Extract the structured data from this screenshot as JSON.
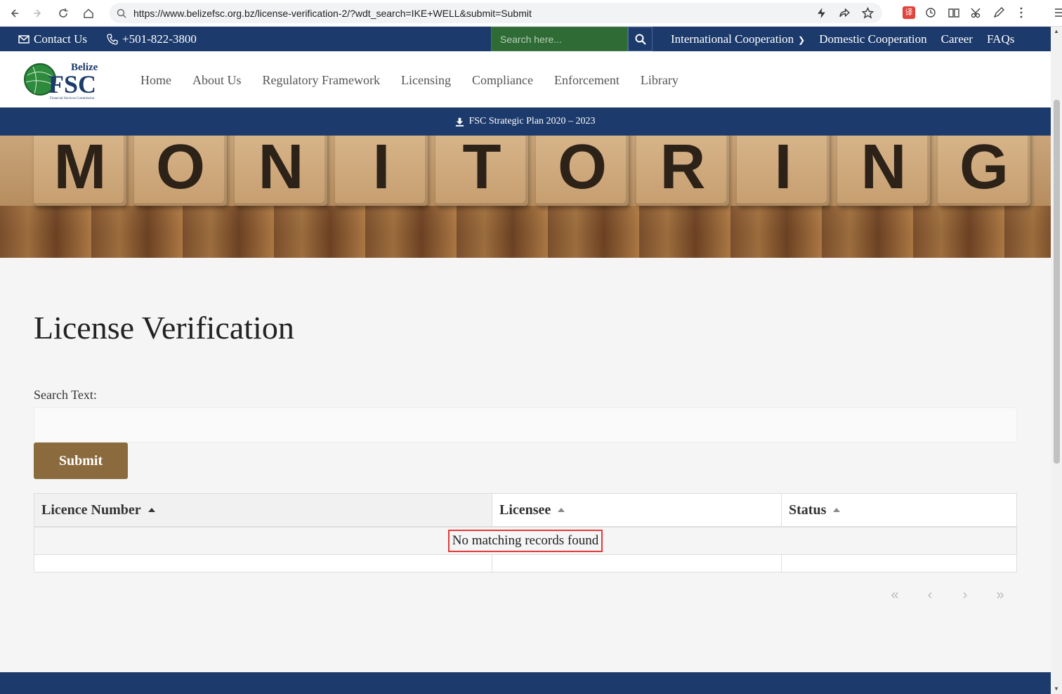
{
  "browser": {
    "url": "https://www.belizefsc.org.bz/license-verification-2/?wdt_search=IKE+WELL&submit=Submit"
  },
  "topbar": {
    "contact_label": "Contact Us",
    "phone": "+501-822-3800",
    "search_placeholder": "Search here...",
    "links": [
      "International Cooperation",
      "Domestic Cooperation",
      "Career",
      "FAQs"
    ]
  },
  "header": {
    "logo_top": "Belize",
    "logo_main": "FSC",
    "logo_sub": "Financial Services Commission",
    "nav": [
      "Home",
      "About Us",
      "Regulatory Framework",
      "Licensing",
      "Compliance",
      "Enforcement",
      "Library"
    ]
  },
  "planbar": {
    "label": "FSC Strategic Plan 2020 – 2023"
  },
  "hero": {
    "letters": [
      "M",
      "O",
      "N",
      "I",
      "T",
      "O",
      "R",
      "I",
      "N",
      "G"
    ]
  },
  "main": {
    "title": "License Verification",
    "search_label": "Search Text:",
    "search_value": "",
    "submit_label": "Submit",
    "table": {
      "columns": [
        "Licence Number",
        "Licensee",
        "Status"
      ],
      "empty_message": "No matching records found"
    },
    "pager": [
      "«",
      "‹",
      "›",
      "»"
    ]
  },
  "colors": {
    "navy": "#1c3a6b",
    "search_green": "#2e6b35",
    "submit_brown": "#8b6b3d",
    "highlight_red": "#e23b3b"
  }
}
